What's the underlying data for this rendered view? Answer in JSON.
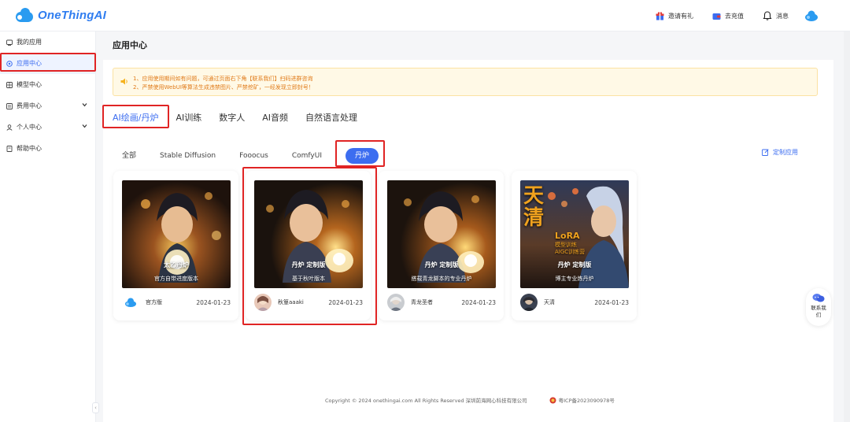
{
  "header": {
    "logo_text": "OneThingAI",
    "actions": [
      {
        "label": "邀请有礼",
        "icon": "gift-icon"
      },
      {
        "label": "去充值",
        "icon": "wallet-icon"
      },
      {
        "label": "消息",
        "icon": "bell-icon"
      }
    ]
  },
  "sidebar": {
    "items": [
      {
        "label": "我的应用",
        "icon": "apps-icon"
      },
      {
        "label": "应用中心",
        "icon": "app-center-icon",
        "active": true
      },
      {
        "label": "模型中心",
        "icon": "model-icon"
      },
      {
        "label": "费用中心",
        "icon": "billing-icon",
        "expandable": true
      },
      {
        "label": "个人中心",
        "icon": "user-icon",
        "expandable": true
      },
      {
        "label": "帮助中心",
        "icon": "help-icon"
      }
    ]
  },
  "page": {
    "title": "应用中心"
  },
  "notice": {
    "line1": "1、应用使用期间如有问题，可通过页面右下角【联系我们】扫码进群咨询",
    "line2": "2、严禁使用WebUI等算法生成违禁图片、严禁挖矿，一经发现立即封号！"
  },
  "category_tabs": [
    {
      "label": "AI绘画/丹炉",
      "active": true
    },
    {
      "label": "AI训练"
    },
    {
      "label": "数字人"
    },
    {
      "label": "AI音频"
    },
    {
      "label": "自然语言处理"
    }
  ],
  "sub_tabs": [
    {
      "label": "全部"
    },
    {
      "label": "Stable Diffusion"
    },
    {
      "label": "Fooocus"
    },
    {
      "label": "ComfyUI"
    },
    {
      "label": "丹炉",
      "active": true
    }
  ],
  "custom_app_label": "定制应用",
  "cards": [
    {
      "thumb_title": "太乙丹炉",
      "thumb_sub": "官方自带进度版本",
      "author": "官方版",
      "date": "2024-01-23"
    },
    {
      "thumb_title": "丹炉 定制版",
      "thumb_sub": "基于秋叶版本",
      "author": "秋篁aaaki",
      "date": "2024-01-23"
    },
    {
      "thumb_title": "丹炉 定制版",
      "thumb_sub": "搭载青龙脚本的专业丹炉",
      "author": "青龙圣者",
      "date": "2024-01-23"
    },
    {
      "thumb_title": "丹炉 定制版",
      "thumb_sub": "博主专业炼丹炉",
      "author": "天清",
      "date": "2024-01-23",
      "poster_big": "天清",
      "poster_small_1": "LoRA",
      "poster_small_2": "模型训练",
      "poster_small_3": "AIGC训练营"
    }
  ],
  "contact": {
    "label": "联系我们"
  },
  "footer": {
    "copyright": "Copyright © 2024 onethingai.com All Rights Reserved 深圳前海网心科技有限公司",
    "icp": "粤ICP备2023090978号"
  },
  "colors": {
    "accent": "#3c6df0",
    "highlight_box": "#e02424",
    "notice_text": "#e07b1a"
  }
}
